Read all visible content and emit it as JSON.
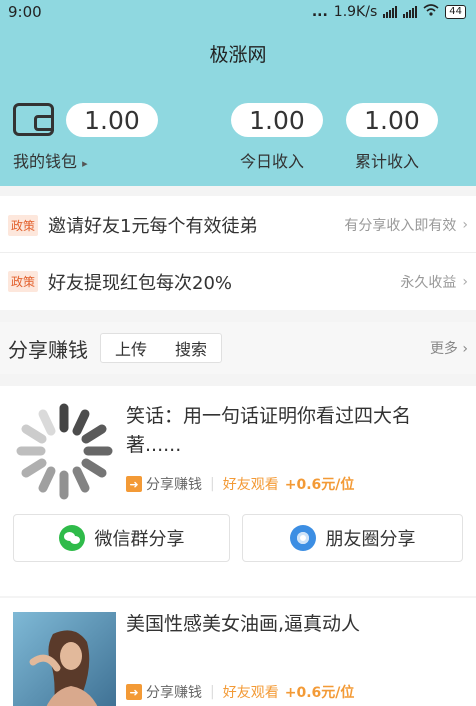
{
  "status_bar": {
    "time": "9:00",
    "dots": "...",
    "speed": "1.9K/s",
    "battery": "44"
  },
  "header": {
    "title": "极涨网",
    "wallet_amount": "1.00",
    "wallet_label": "我的钱包",
    "wallet_chevron": "▸",
    "today_amount": "1.00",
    "today_label": "今日收入",
    "total_amount": "1.00",
    "total_label": "累计收入"
  },
  "policies": [
    {
      "tag": "政策",
      "text": "邀请好友1元每个有效徒弟",
      "note": "有分享收入即有效",
      "chevron": "›"
    },
    {
      "tag": "政策",
      "text": "好友提现红包每次20%",
      "note": "永久收益",
      "chevron": "›"
    }
  ],
  "section": {
    "title": "分享赚钱",
    "tabs": [
      "上传",
      "搜索"
    ],
    "more": "更多",
    "more_chevron": "›"
  },
  "articles": [
    {
      "title": "笑话：用一句话证明你看过四大名著......",
      "share_label": "分享赚钱",
      "divider": "|",
      "friend_view": "好友观看",
      "bonus": "+0.6元/位",
      "wechat_group": "微信群分享",
      "moments": "朋友圈分享"
    },
    {
      "title": "美国性感美女油画,逼真动人",
      "share_label": "分享赚钱",
      "divider": "|",
      "friend_view": "好友观看",
      "bonus": "+0.6元/位"
    }
  ],
  "icons": {
    "wallet": "wallet-icon",
    "share": "share-icon",
    "wechat": "wechat-icon",
    "moments": "moments-icon",
    "loading": "loading-spinner-icon"
  },
  "colors": {
    "header_bg": "#8fd8e0",
    "accent_orange": "#f39a36",
    "policy_tag": "#e2602c",
    "wechat_green": "#2fbb4a",
    "moments_blue": "#3c8ee3"
  }
}
